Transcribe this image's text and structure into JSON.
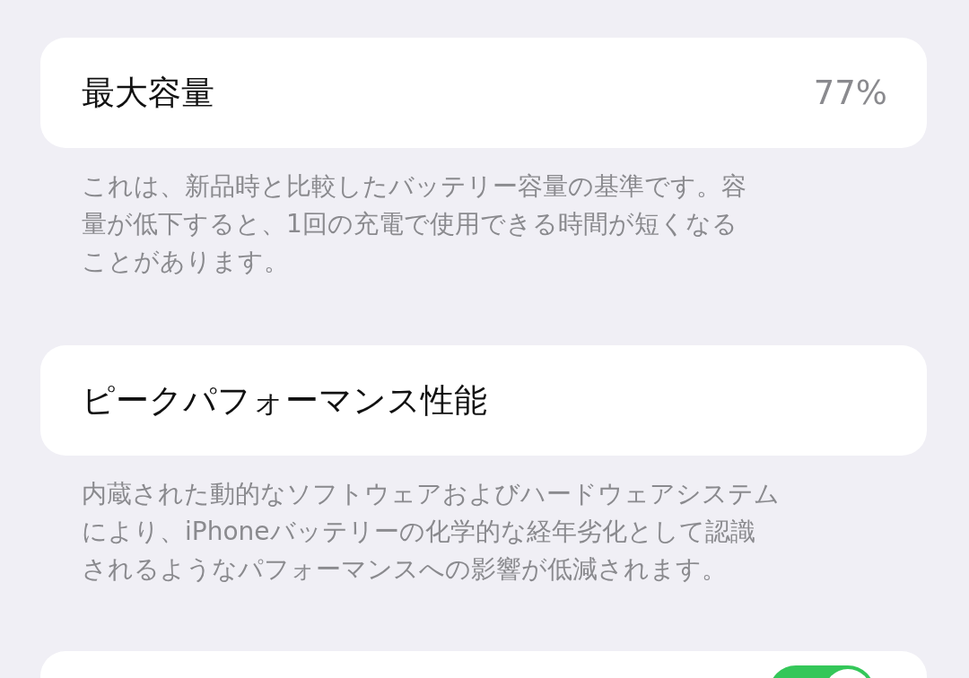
{
  "sections": [
    {
      "title": "最大容量",
      "value": "77%",
      "note_lines": [
        "これは、新品時と比較したバッテリー容量の基準です。容",
        "量が低下すると、1回の充電で使用できる時間が短くなる",
        "ことがあります。"
      ]
    },
    {
      "title": "ピークパフォーマンス性能",
      "note_lines": [
        "内蔵された動的なソフトウェアおよびハードウェアシステム",
        "により、iPhoneバッテリーの化学的な経年劣化として認識",
        "されるようなパフォーマンスへの影響が低減されます。"
      ]
    }
  ],
  "bottom_card": {
    "toggle": {
      "on": true
    }
  }
}
